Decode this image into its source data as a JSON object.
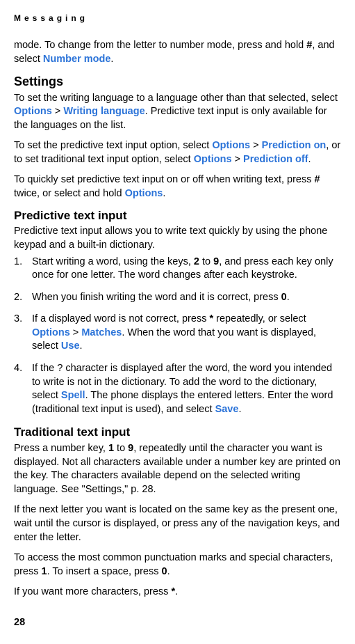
{
  "header": "Messaging",
  "page_number": "28",
  "intro_segments": {
    "s1": "mode. To change from the letter to number mode, press and hold ",
    "key_hash": "#",
    "s2": ", and select ",
    "link_number_mode": "Number mode",
    "s3": "."
  },
  "settings": {
    "heading": "Settings",
    "p1": {
      "s1": "To set the writing language to a language other than that selected, select ",
      "link_options": "Options",
      "gt": " > ",
      "link_writing_language": "Writing language",
      "s2": ". Predictive text input is only available for the languages on the list."
    },
    "p2": {
      "s1": "To set the predictive text input option, select ",
      "link_options": "Options",
      "gt1": " > ",
      "link_pred_on": "Prediction on",
      "s2": ", or to set traditional text input option, select ",
      "link_options2": "Options",
      "gt2": " > ",
      "link_pred_off": "Prediction off",
      "s3": "."
    },
    "p3": {
      "s1": "To quickly set predictive text input on or off when writing text, press ",
      "key_hash": "#",
      "s2": " twice, or select and hold ",
      "link_options": "Options",
      "s3": "."
    }
  },
  "predictive": {
    "heading": "Predictive text input",
    "intro": "Predictive text input allows you to write text quickly by using the phone keypad and a built-in dictionary.",
    "li1": {
      "s1": "Start writing a word, using the keys, ",
      "k2": "2",
      "to": " to ",
      "k9": "9",
      "s2": ", and press each key only once for one letter. The word changes after each keystroke."
    },
    "li2": {
      "s1": "When you finish writing the word and it is correct, press ",
      "k0": "0",
      "s2": "."
    },
    "li3": {
      "s1": "If a displayed word is not correct, press ",
      "kstar": "*",
      "s2": " repeatedly, or select ",
      "link_options": "Options",
      "gt": " > ",
      "link_matches": "Matches",
      "s3": ". When the word that you want is displayed, select ",
      "link_use": "Use",
      "s4": "."
    },
    "li4": {
      "s1": "If the ? character is displayed after the word, the word you intended to write is not in the dictionary. To add the word to the dictionary, select ",
      "link_spell": "Spell",
      "s2": ". The phone displays the entered letters. Enter the word (traditional text input is used), and select ",
      "link_save": "Save",
      "s3": "."
    }
  },
  "traditional": {
    "heading": "Traditional text input",
    "p1": {
      "s1": "Press a number key, ",
      "k1": "1",
      "to": " to ",
      "k9": "9",
      "s2": ", repeatedly until the character you want is displayed. Not all characters available under a number key are printed on the key. The characters available depend on the selected writing language. See \"Settings,\" p. 28."
    },
    "p2": "If the next letter you want is located on the same key as the present one, wait until the cursor is displayed, or press any of the navigation keys, and enter the letter.",
    "p3": {
      "s1": "To access the most common punctuation marks and special characters, press ",
      "k1": "1",
      "s2": ". To insert a space, press ",
      "k0": "0",
      "s3": "."
    },
    "p4": {
      "s1": "If you want more characters, press ",
      "kstar": "*",
      "s2": "."
    }
  }
}
